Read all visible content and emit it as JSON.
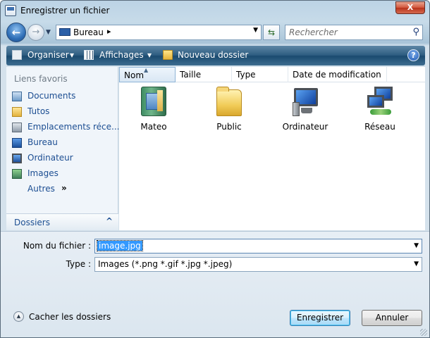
{
  "window": {
    "title": "Enregistrer un fichier",
    "close_label": "X"
  },
  "nav": {
    "back_label": "←",
    "forward_label": "→",
    "address_text": "Bureau",
    "address_separator": "▸",
    "search_placeholder": "Rechercher"
  },
  "toolbar": {
    "organize_label": "Organiser",
    "views_label": "Affichages",
    "new_folder_label": "Nouveau dossier",
    "dropdown_glyph": "▾",
    "help_label": "?"
  },
  "sidebar": {
    "favorites_title": "Liens favoris",
    "items": [
      {
        "label": "Documents",
        "icon": "documents-icon"
      },
      {
        "label": "Tutos",
        "icon": "folder-icon"
      },
      {
        "label": "Emplacements réce...",
        "icon": "recent-places-icon"
      },
      {
        "label": "Bureau",
        "icon": "desktop-icon"
      },
      {
        "label": "Ordinateur",
        "icon": "computer-icon"
      },
      {
        "label": "Images",
        "icon": "pictures-icon"
      }
    ],
    "more_label": "Autres",
    "more_glyph": "»",
    "folders_label": "Dossiers",
    "folders_glyph": "^"
  },
  "columns": [
    "Nom",
    "Taille",
    "Type",
    "Date de modification"
  ],
  "files": [
    {
      "label": "Mateo",
      "icon": "user-folder-icon"
    },
    {
      "label": "Public",
      "icon": "folder-icon"
    },
    {
      "label": "Ordinateur",
      "icon": "computer-icon"
    },
    {
      "label": "Réseau",
      "icon": "network-icon"
    }
  ],
  "form": {
    "filename_label": "Nom du fichier :",
    "filename_value": "image.jpg",
    "type_label": "Type :",
    "type_value": "Images (*.png *.gif *.jpg *.jpeg)",
    "dropdown_glyph": "▼"
  },
  "footer": {
    "hide_folders_label": "Cacher les dossiers",
    "hide_folders_glyph": "▲",
    "save_label": "Enregistrer",
    "cancel_label": "Annuler"
  },
  "colors": {
    "toolbar": "#2d5c80",
    "link": "#1c4e92",
    "selection": "#3399ff"
  }
}
